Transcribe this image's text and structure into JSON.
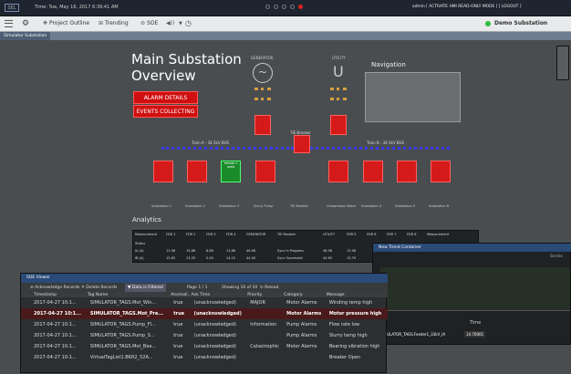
{
  "topbar": {
    "logo": "SEL",
    "datetime": "Time: Tue, May 16, 2017 6:39:41 AM",
    "right_text": "admin [ ACTIVATE HMI READ-ONLY MODE ] [ LOGOUT ]"
  },
  "toolbar": {
    "project_outline": "Project Outline",
    "trending": "Trending",
    "soe": "SOE",
    "status_label": "Demo Substation"
  },
  "tabs": {
    "active": "Simulator Substation"
  },
  "diagram": {
    "title_line1": "Main Substation",
    "title_line2": "Overview",
    "alarm_button": "ALARM DETAILS",
    "events_button": "EVENTS COLLECTING",
    "generator_label": "GENERATOR",
    "utility_label": "UTILITY",
    "navigation_label": "Navigation",
    "tie_breaker_label": "TIE Breaker",
    "bus_a_label": "Train A - 34.5kV BUS",
    "bus_b_label": "Train B - 34.5kV BUS",
    "feeder_open_label": "FEEDER 3 OPEN",
    "substations": [
      "Substation 1",
      "Substation 2",
      "Substation 3",
      "Slurry Pump",
      "TIE Breaker",
      "Compressor Motor",
      "Substation 4",
      "Substation 5",
      "Substation 6"
    ],
    "analytics_label": "Analytics"
  },
  "analytics": {
    "headers": [
      "Measurement",
      "FDR 1",
      "FDR 2",
      "FDR 3",
      "FDR 4",
      "GENERATOR",
      "TIE Breaker",
      "UTILITY",
      "FDR 5",
      "FDR 6",
      "FDR 7",
      "FDR 8",
      "Measurement"
    ],
    "rows": [
      [
        "Status",
        "",
        "",
        "",
        "",
        "",
        "",
        "",
        "",
        "",
        "",
        "",
        ""
      ],
      [
        "IA (A)",
        "11.98",
        "15.88",
        "8.88",
        "13.88",
        "46.98",
        "Sync in Progress",
        "48.98",
        "13.98",
        "",
        "",
        "",
        ""
      ],
      [
        "IB (A)",
        "12.63",
        "13.33",
        "0.00",
        "14.15",
        "44.40",
        "Sync Successful",
        "44.63",
        "13.79",
        "",
        "",
        "",
        ""
      ]
    ]
  },
  "trend": {
    "title": "New Trend Container",
    "series_label": "Series",
    "time_label": "Time",
    "legend_tag": "SIMULATOR_TAGS.Feeder1_33kV_IA",
    "legend_value": "14.70001"
  },
  "soe": {
    "title": "SOE Viewer",
    "ack_records": "Acknowledge Records",
    "delete_records": "Delete Records",
    "filter_label": "Data is Filtered",
    "page_text": "Page 1 / 1",
    "showing_text": "Showing 10 of 10",
    "reload": "Reload",
    "columns": [
      "Timestamp",
      "Tag Name",
      "Anomali..",
      "Ack Time",
      "Priority",
      "Category",
      "Message"
    ],
    "rows": [
      [
        "2017-04-27 10:1...",
        "SIMULATOR_TAGS.Mot_Win...",
        "true",
        "(unacknowledged)",
        "MAJOR",
        "Motor Alarms",
        "Winding temp high"
      ],
      [
        "2017-04-27 10:1...",
        "SIMULATOR_TAGS.Mot_Pre...",
        "true",
        "(unacknowledged)",
        "",
        "Motor Alarms",
        "Motor pressure high"
      ],
      [
        "2017-04-27 10:1...",
        "SIMULATOR_TAGS.Pump_Fl...",
        "true",
        "(unacknowledged)",
        "Information",
        "Pump Alarms",
        "Flow rate low"
      ],
      [
        "2017-04-27 10:1...",
        "SIMULATOR_TAGS.Pump_S...",
        "true",
        "(unacknowledged)",
        "",
        "Pump Alarms",
        "Slurry temp high"
      ],
      [
        "2017-04-27 10:1...",
        "SIMULATOR_TAGS.Mot_Bea...",
        "true",
        "(unacknowledged)",
        "Catastrophic",
        "Motor Alarms",
        "Bearing vibration high"
      ],
      [
        "2017-04-27 10:1...",
        "VirtualTagList1.BKR2_52A...",
        "true",
        "(unacknowledged)",
        "",
        "",
        "Breaker Open"
      ]
    ]
  },
  "colors": {
    "alarm_red": "#d01010",
    "closed_green": "#1a8a2a",
    "bus_blue": "#3a3aff",
    "trend_green": "#2ea84a"
  }
}
